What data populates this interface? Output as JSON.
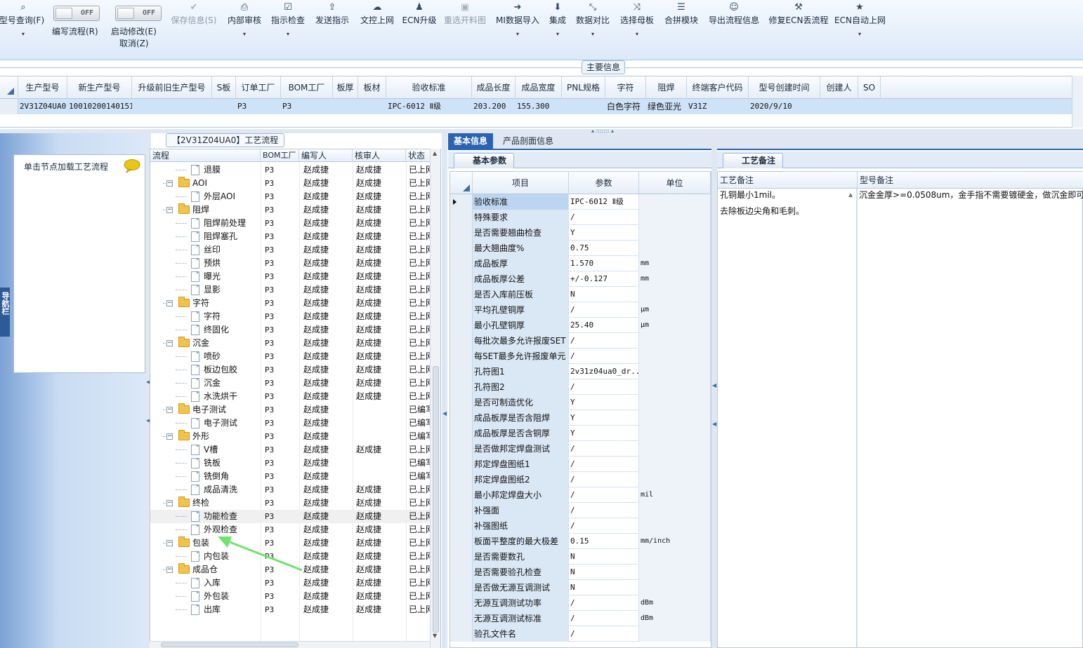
{
  "toolbar": {
    "items": [
      {
        "label": "型号查询(F)",
        "icon": "search-icon",
        "glyph": "🔍",
        "disabled": false
      },
      {
        "label": "保存信息(S)",
        "icon": "check-icon",
        "glyph": "✔",
        "disabled": true
      },
      {
        "label": "内部审核",
        "icon": "printer-icon",
        "glyph": "🖶",
        "disabled": false
      },
      {
        "label": "指示检查",
        "icon": "checkbox-icon",
        "glyph": "☑",
        "disabled": false
      },
      {
        "label": "发送指示",
        "icon": "upload-icon",
        "glyph": "⇪",
        "disabled": false
      },
      {
        "label": "文控上网",
        "icon": "cloud-upload-icon",
        "glyph": "☁",
        "disabled": false
      },
      {
        "label": "ECN升级",
        "icon": "users-icon",
        "glyph": "👥",
        "disabled": false
      },
      {
        "label": "重选开料图",
        "icon": "image-icon",
        "glyph": "▣",
        "disabled": true
      },
      {
        "label": "MI数据导入",
        "icon": "sign-in-icon",
        "glyph": "➜",
        "disabled": false
      },
      {
        "label": "集成",
        "icon": "download-icon",
        "glyph": "⬇",
        "disabled": false
      },
      {
        "label": "数据对比",
        "icon": "compress-icon",
        "glyph": "⤡",
        "disabled": false
      },
      {
        "label": "选择母板",
        "icon": "shuffle-icon",
        "glyph": "⤨",
        "disabled": false
      },
      {
        "label": "合拼模块",
        "icon": "list-icon",
        "glyph": "☰",
        "disabled": false
      },
      {
        "label": "导出流程信息",
        "icon": "smile-icon",
        "glyph": "☺",
        "disabled": false
      },
      {
        "label": "修复ECN丢流程",
        "icon": "wrench-icon",
        "glyph": "🔧",
        "disabled": false
      },
      {
        "label": "ECN自动上网",
        "icon": "star-icon",
        "glyph": "★",
        "disabled": false
      }
    ],
    "toggles": [
      {
        "state": "OFF",
        "label": "编写流程(R)"
      },
      {
        "state": "OFF",
        "label": "启动修改(E)"
      }
    ],
    "cancel_label": "取消(Z)"
  },
  "main_info": {
    "title": "主要信息",
    "columns": [
      "生产型号",
      "新生产型号",
      "升级前旧生产型号",
      "S板",
      "订单工厂",
      "BOM工厂",
      "板厚",
      "板材",
      "验收标准",
      "成品长度",
      "成品宽度",
      "PNL规格",
      "字符",
      "阻焊",
      "终端客户代码",
      "型号创建时间",
      "创建人",
      "SO"
    ],
    "row": [
      "2V31Z04UA0",
      "10010200140151",
      "",
      "",
      "P3",
      "P3",
      "",
      "",
      "IPC-6012 Ⅱ级",
      "203.200",
      "155.300",
      "",
      "白色字符",
      "绿色亚光",
      "V31Z",
      "2020/9/10",
      "",
      ""
    ]
  },
  "left_panel": {
    "vertical_tab": "导航栏",
    "hint": "单击节点加载工艺流程",
    "hint_icon": "chat-bubble-icon"
  },
  "process_tree": {
    "title": "【2V31Z04UA0】工艺流程",
    "columns": [
      "流程",
      "BOM工厂",
      "编写人",
      "核审人",
      "状态"
    ],
    "rows": [
      {
        "name": "退膜",
        "level": 1,
        "type": "doc",
        "bom": "P3",
        "writer": "赵成捷",
        "reviewer": "赵成捷",
        "status": "已上网"
      },
      {
        "name": "AOI",
        "level": 0,
        "type": "folder",
        "bom": "P3",
        "writer": "赵成捷",
        "reviewer": "赵成捷",
        "status": "已上网"
      },
      {
        "name": "外层AOI",
        "level": 1,
        "type": "doc",
        "bom": "P3",
        "writer": "赵成捷",
        "reviewer": "赵成捷",
        "status": "已上网"
      },
      {
        "name": "阻焊",
        "level": 0,
        "type": "folder",
        "bom": "P3",
        "writer": "赵成捷",
        "reviewer": "赵成捷",
        "status": "已上网"
      },
      {
        "name": "阻焊前处理",
        "level": 1,
        "type": "doc",
        "bom": "P3",
        "writer": "赵成捷",
        "reviewer": "赵成捷",
        "status": "已上网"
      },
      {
        "name": "阻焊塞孔",
        "level": 1,
        "type": "doc",
        "bom": "P3",
        "writer": "赵成捷",
        "reviewer": "赵成捷",
        "status": "已上网"
      },
      {
        "name": "丝印",
        "level": 1,
        "type": "doc",
        "bom": "P3",
        "writer": "赵成捷",
        "reviewer": "赵成捷",
        "status": "已上网"
      },
      {
        "name": "预烘",
        "level": 1,
        "type": "doc",
        "bom": "P3",
        "writer": "赵成捷",
        "reviewer": "赵成捷",
        "status": "已上网"
      },
      {
        "name": "曝光",
        "level": 1,
        "type": "doc",
        "bom": "P3",
        "writer": "赵成捷",
        "reviewer": "赵成捷",
        "status": "已上网"
      },
      {
        "name": "显影",
        "level": 1,
        "type": "doc",
        "bom": "P3",
        "writer": "赵成捷",
        "reviewer": "赵成捷",
        "status": "已上网"
      },
      {
        "name": "字符",
        "level": 0,
        "type": "folder",
        "bom": "P3",
        "writer": "赵成捷",
        "reviewer": "赵成捷",
        "status": "已上网"
      },
      {
        "name": "字符",
        "level": 1,
        "type": "doc",
        "bom": "P3",
        "writer": "赵成捷",
        "reviewer": "赵成捷",
        "status": "已上网"
      },
      {
        "name": "终固化",
        "level": 1,
        "type": "doc",
        "bom": "P3",
        "writer": "赵成捷",
        "reviewer": "赵成捷",
        "status": "已上网"
      },
      {
        "name": "沉金",
        "level": 0,
        "type": "folder",
        "bom": "P3",
        "writer": "赵成捷",
        "reviewer": "赵成捷",
        "status": "已上网"
      },
      {
        "name": "喷砂",
        "level": 1,
        "type": "doc",
        "bom": "P3",
        "writer": "赵成捷",
        "reviewer": "赵成捷",
        "status": "已上网"
      },
      {
        "name": "板边包胶",
        "level": 1,
        "type": "doc",
        "bom": "P3",
        "writer": "赵成捷",
        "reviewer": "赵成捷",
        "status": "已上网"
      },
      {
        "name": "沉金",
        "level": 1,
        "type": "doc",
        "bom": "P3",
        "writer": "赵成捷",
        "reviewer": "赵成捷",
        "status": "已上网"
      },
      {
        "name": "水洗烘干",
        "level": 1,
        "type": "doc",
        "bom": "P3",
        "writer": "赵成捷",
        "reviewer": "赵成捷",
        "status": "已上网"
      },
      {
        "name": "电子测试",
        "level": 0,
        "type": "folder",
        "bom": "P3",
        "writer": "赵成捷",
        "reviewer": "",
        "status": "已编写"
      },
      {
        "name": "电子测试",
        "level": 1,
        "type": "doc",
        "bom": "P3",
        "writer": "赵成捷",
        "reviewer": "",
        "status": "已编写"
      },
      {
        "name": "外形",
        "level": 0,
        "type": "folder",
        "bom": "P3",
        "writer": "赵成捷",
        "reviewer": "",
        "status": "已编写"
      },
      {
        "name": "V槽",
        "level": 1,
        "type": "doc",
        "bom": "P3",
        "writer": "赵成捷",
        "reviewer": "赵成捷",
        "status": "已上网"
      },
      {
        "name": "铣板",
        "level": 1,
        "type": "doc",
        "bom": "P3",
        "writer": "赵成捷",
        "reviewer": "",
        "status": "已编写"
      },
      {
        "name": "铣倒角",
        "level": 1,
        "type": "doc",
        "bom": "P3",
        "writer": "赵成捷",
        "reviewer": "",
        "status": "已编写"
      },
      {
        "name": "成品清洗",
        "level": 1,
        "type": "doc",
        "bom": "P3",
        "writer": "赵成捷",
        "reviewer": "赵成捷",
        "status": "已上网"
      },
      {
        "name": "终检",
        "level": 0,
        "type": "folder",
        "bom": "P3",
        "writer": "赵成捷",
        "reviewer": "赵成捷",
        "status": "已上网"
      },
      {
        "name": "功能检查",
        "level": 1,
        "type": "doc",
        "bom": "P3",
        "writer": "赵成捷",
        "reviewer": "赵成捷",
        "status": "已上网",
        "highlight": true
      },
      {
        "name": "外观检查",
        "level": 1,
        "type": "doc",
        "bom": "P3",
        "writer": "赵成捷",
        "reviewer": "赵成捷",
        "status": "已上网"
      },
      {
        "name": "包装",
        "level": 0,
        "type": "folder",
        "bom": "P3",
        "writer": "赵成捷",
        "reviewer": "赵成捷",
        "status": "已上网"
      },
      {
        "name": "内包装",
        "level": 1,
        "type": "doc",
        "bom": "P3",
        "writer": "赵成捷",
        "reviewer": "赵成捷",
        "status": "已上网"
      },
      {
        "name": "成品仓",
        "level": 0,
        "type": "folder",
        "bom": "P3",
        "writer": "赵成捷",
        "reviewer": "赵成捷",
        "status": "已上网"
      },
      {
        "name": "入库",
        "level": 1,
        "type": "doc",
        "bom": "P3",
        "writer": "赵成捷",
        "reviewer": "赵成捷",
        "status": "已上网"
      },
      {
        "name": "外包装",
        "level": 1,
        "type": "doc",
        "bom": "P3",
        "writer": "赵成捷",
        "reviewer": "赵成捷",
        "status": "已上网"
      },
      {
        "name": "出库",
        "level": 1,
        "type": "doc",
        "bom": "P3",
        "writer": "赵成捷",
        "reviewer": "赵成捷",
        "status": "已上网"
      }
    ]
  },
  "right_tabs": {
    "tabs": [
      "基本信息",
      "产品剖面信息"
    ],
    "active_index": 0
  },
  "basic_params": {
    "subtab": "基本参数",
    "columns": [
      "项目",
      "参数",
      "单位"
    ],
    "rows": [
      [
        "验收标准",
        "IPC-6012 Ⅱ级",
        ""
      ],
      [
        "特殊要求",
        "/",
        ""
      ],
      [
        "是否需要翘曲检查",
        "Y",
        ""
      ],
      [
        "最大翘曲度%",
        "0.75",
        ""
      ],
      [
        "成品板厚",
        "1.570",
        "mm"
      ],
      [
        "成品板厚公差",
        "+/-0.127",
        "mm"
      ],
      [
        "是否入库前压板",
        "N",
        ""
      ],
      [
        "平均孔壁铜厚",
        "/",
        "μm"
      ],
      [
        "最小孔壁铜厚",
        "25.40",
        "μm"
      ],
      [
        "每批次最多允许报废SET",
        "/",
        ""
      ],
      [
        "每SET最多允许报废单元",
        "/",
        ""
      ],
      [
        "孔符图1",
        "2v31z04ua0_dr...",
        ""
      ],
      [
        "孔符图2",
        "/",
        ""
      ],
      [
        "是否可制造优化",
        "Y",
        ""
      ],
      [
        "成品板厚是否含阻焊",
        "Y",
        ""
      ],
      [
        "成品板厚是否含铜厚",
        "Y",
        ""
      ],
      [
        "是否做邦定焊盘测试",
        "/",
        ""
      ],
      [
        "邦定焊盘图纸1",
        "/",
        ""
      ],
      [
        "邦定焊盘图纸2",
        "/",
        ""
      ],
      [
        "最小邦定焊盘大小",
        "/",
        "mil"
      ],
      [
        "补强面",
        "/",
        ""
      ],
      [
        "补强图纸",
        "/",
        ""
      ],
      [
        "板面平整度的最大极差",
        "0.15",
        "mm/inch"
      ],
      [
        "是否需要数孔",
        "N",
        ""
      ],
      [
        "是否需要验孔检查",
        "N",
        ""
      ],
      [
        "是否做无源互调测试",
        "N",
        ""
      ],
      [
        "无源互调测试功率",
        "/",
        "dBm"
      ],
      [
        "无源互调测试标准",
        "/",
        "dBm"
      ],
      [
        "验孔文件名",
        "/",
        ""
      ]
    ]
  },
  "notes": {
    "subtab": "工艺备注",
    "process_header": "工艺备注",
    "model_header": "型号备注",
    "process_lines": [
      "孔铜最小1mil。",
      "去除板边尖角和毛刺。"
    ],
    "model_lines": [
      "沉金金厚>=0.0508um，金手指不需要镀硬金，做沉金即可"
    ]
  },
  "colors": {
    "accent": "#2b63b0",
    "selected_row": "#cfe3f8",
    "folder": "#f2c34a",
    "annotation_arrow": "#6ee36e"
  }
}
